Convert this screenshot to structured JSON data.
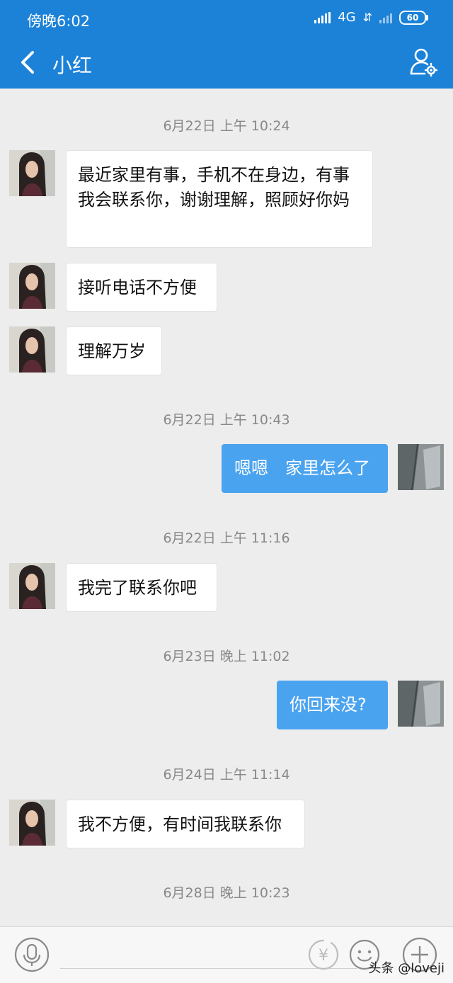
{
  "status": {
    "time": "傍晚6:02",
    "network": "4G",
    "arrows": "⇵",
    "battery": "60"
  },
  "header": {
    "title": "小红"
  },
  "messages": [
    {
      "timestamp": "6月22日 上午 10:24"
    },
    {
      "text": "最近家里有事，手机不在身边，有事我会联系你，谢谢理解，照顾好你妈"
    },
    {
      "text": "接听电话不方便"
    },
    {
      "text": "理解万岁"
    },
    {
      "timestamp": "6月22日 上午 10:43"
    },
    {
      "text": "嗯嗯　家里怎么了"
    },
    {
      "timestamp": "6月22日 上午 11:16"
    },
    {
      "text": "我完了联系你吧"
    },
    {
      "timestamp": "6月23日 晚上 11:02"
    },
    {
      "text": "你回来没?"
    },
    {
      "timestamp": "6月24日 上午 11:14"
    },
    {
      "text": "我不方便，有时间我联系你"
    },
    {
      "timestamp": "6月28日 晚上 10:23"
    }
  ],
  "footer": {
    "watermark": "头条 @loveji"
  },
  "icons": {
    "back": "chevron-left-icon",
    "profile": "user-settings-icon",
    "voice": "microphone-icon",
    "redpacket": "yuan-icon",
    "emoji": "smiley-icon",
    "more": "plus-icon"
  },
  "colors": {
    "primary": "#1c82d8",
    "outgoing_bubble": "#4aa3ef",
    "background": "#ededed"
  }
}
